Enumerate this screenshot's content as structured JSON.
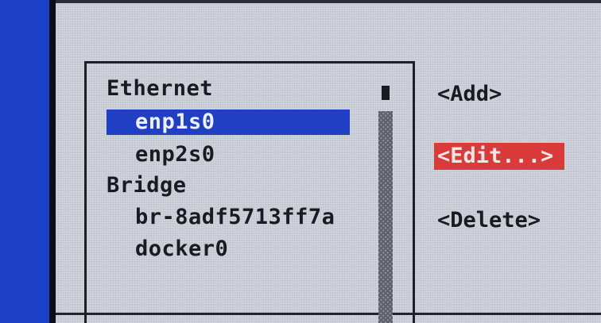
{
  "connections": {
    "groups": [
      {
        "label": "Ethernet",
        "items": [
          {
            "label": "enp1s0"
          },
          {
            "label": "enp2s0"
          }
        ]
      },
      {
        "label": "Bridge",
        "items": [
          {
            "label": "br-8adf5713ff7a"
          },
          {
            "label": "docker0"
          }
        ]
      }
    ],
    "selected": "enp1s0"
  },
  "buttons": {
    "add": "<Add>",
    "edit": "<Edit...>",
    "delete": "<Delete>"
  },
  "colors": {
    "background": "#1e46d2",
    "window": "#c9cdd6",
    "selection": "#1f3fc4",
    "focused_button": "#d93a3a"
  }
}
